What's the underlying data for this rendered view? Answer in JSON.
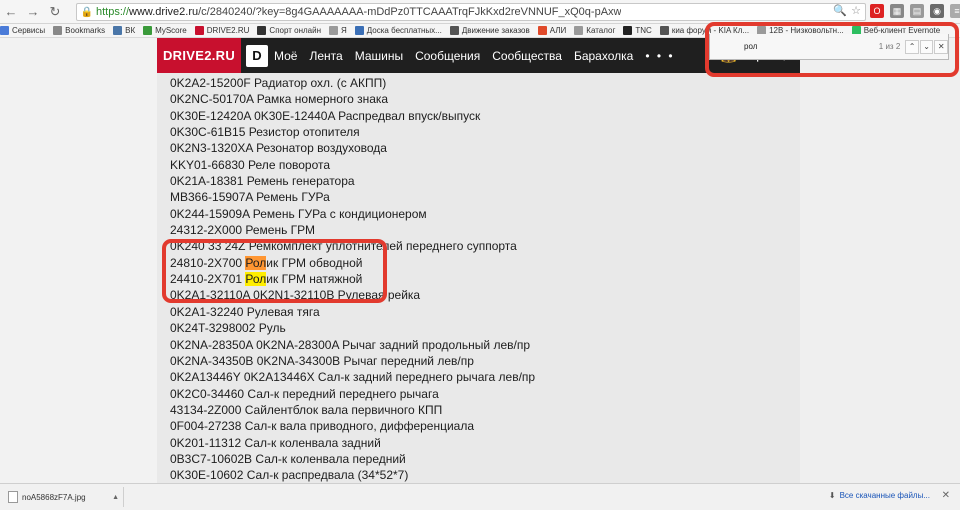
{
  "browser": {
    "url_scheme": "https://",
    "url_host": "www.drive2.ru",
    "url_path": "/c/2840240/?key=8g4GAAAAAAA-mDdPz0TTCAAATrqFJkKxd2reVNNUF_xQ0q-pAxw",
    "nav_back": "←",
    "nav_forward": "→",
    "nav_reload": "↻",
    "nav_home": "⌂"
  },
  "bookmarks": [
    {
      "label": "Сервисы",
      "icon": "apps-icon",
      "color": "#4a7bd8"
    },
    {
      "label": "Bookmarks",
      "icon": "star-icon",
      "color": "#888888"
    },
    {
      "label": "ВК",
      "icon": "vk-icon",
      "color": "#4a76a8"
    },
    {
      "label": "MyScore",
      "icon": "myscore-icon",
      "color": "#3a9a3a"
    },
    {
      "label": "DRIVE2.RU",
      "icon": "drive2-icon",
      "color": "#c8102e"
    },
    {
      "label": "Спорт онлайн",
      "icon": "s-icon",
      "color": "#333333"
    },
    {
      "label": "Я",
      "icon": "page-icon",
      "color": "#9a9a9a"
    },
    {
      "label": "Доска бесплатных...",
      "icon": "board-icon",
      "color": "#3b6fb6"
    },
    {
      "label": "Движение заказов",
      "icon": "car-icon",
      "color": "#555555"
    },
    {
      "label": "АЛИ",
      "icon": "ali-icon",
      "color": "#e04a2a"
    },
    {
      "label": "Каталог",
      "icon": "page-icon",
      "color": "#9a9a9a"
    },
    {
      "label": "TNC",
      "icon": "tnc-icon",
      "color": "#222222"
    },
    {
      "label": "киа форум - KIA Кл...",
      "icon": "car-icon",
      "color": "#555555"
    },
    {
      "label": "12В - Низковольтн...",
      "icon": "page-icon",
      "color": "#9a9a9a"
    },
    {
      "label": "Веб-клиент Evernote",
      "icon": "evernote-icon",
      "color": "#2dbe60"
    }
  ],
  "site": {
    "logo": "DRIVE2.RU",
    "logo_d": "D",
    "menu": [
      "Моё",
      "Лента",
      "Машины",
      "Сообщения",
      "Сообщества",
      "Барахолка"
    ],
    "menu_more": "• • •"
  },
  "find": {
    "query": "рол",
    "count": "1 из 2",
    "prev": "⌃",
    "next": "⌄",
    "close": "✕"
  },
  "parts": [
    {
      "pre": "0K2A2-15200F Радиатор охл. (с АКПП)"
    },
    {
      "pre": "0K2NC-50170A Рамка номерного знака"
    },
    {
      "pre": "0K30E-12420A 0K30E-12440A Распредвал впуск/выпуск"
    },
    {
      "pre": "0K30C-61B15 Резистор отопителя"
    },
    {
      "pre": "0K2N3-1320XA Резонатор воздуховода"
    },
    {
      "pre": "KKY01-66830 Реле поворота"
    },
    {
      "pre": "0K21A-18381 Ремень генератора"
    },
    {
      "pre": "MB366-15907A Ремень ГУРа"
    },
    {
      "pre": "0K244-15909A Ремень ГУРа с кондиционером"
    },
    {
      "pre": "24312-2X000 Ремень ГРМ"
    },
    {
      "pre": "0K240 33 24Z Ремкомплект уплотнителей переднего суппорта"
    },
    {
      "pre": "24810-2X700 ",
      "hl": "Рол",
      "post": "ик ГРМ обводной",
      "active": true
    },
    {
      "pre": "24410-2X701 ",
      "hl": "Рол",
      "post": "ик ГРМ натяжной",
      "active": false
    },
    {
      "pre": "0K2A1-32110A 0K2N1-32110B Рулевая рейка"
    },
    {
      "pre": "0K2A1-32240 Рулевая тяга"
    },
    {
      "pre": "0K24T-3298002 Руль"
    },
    {
      "pre": "0K2NA-28350A 0K2NA-28300A Рычаг задний продольный лев/пр"
    },
    {
      "pre": "0K2NA-34350B 0K2NA-34300B Рычаг передний лев/пр"
    },
    {
      "pre": "0K2A13446Y 0K2A13446X Сал-к задний переднего рычага лев/пр"
    },
    {
      "pre": "0K2C0-34460 Сал-к передний переднего рычага"
    },
    {
      "pre": "43134-2Z000 Сайлентблок вала первичного КПП"
    },
    {
      "pre": "0F004-27238 Сал-к вала приводного, дифференциала"
    },
    {
      "pre": "0K201-11312 Сал-к коленвала задний"
    },
    {
      "pre": "0B3C7-10602B Сал-к коленвала передний"
    },
    {
      "pre": "0K30E-10602 Сал-к распредвала (34*52*7)"
    }
  ],
  "downloads": {
    "file": "noA5868zF7A.jpg",
    "all": "Все скачанные файлы...",
    "arrow": "▲",
    "close": "✕"
  },
  "colors": {
    "annotation": "#e23a2e",
    "highlight": "#ffee00",
    "highlight_active": "#ff9632",
    "site_brand": "#c8102e"
  }
}
